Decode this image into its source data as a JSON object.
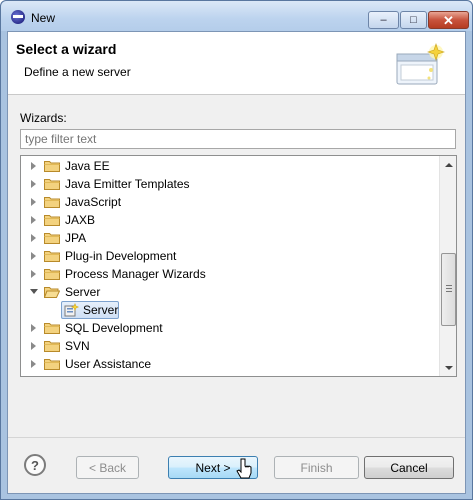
{
  "window": {
    "title": "New",
    "controls": {
      "minimize": "‒",
      "maximize": "□",
      "close": "✕"
    }
  },
  "header": {
    "title": "Select a wizard",
    "description": "Define a new server",
    "banner_icon": "new-wizard-banner-icon"
  },
  "wizards": {
    "label": "Wizards:",
    "filter_placeholder": "type filter text",
    "tree": [
      {
        "label": "Java EE",
        "expanded": false
      },
      {
        "label": "Java Emitter Templates",
        "expanded": false
      },
      {
        "label": "JavaScript",
        "expanded": false
      },
      {
        "label": "JAXB",
        "expanded": false
      },
      {
        "label": "JPA",
        "expanded": false
      },
      {
        "label": "Plug-in Development",
        "expanded": false
      },
      {
        "label": "Process Manager Wizards",
        "expanded": false
      },
      {
        "label": "Server",
        "expanded": true,
        "children": [
          {
            "label": "Server",
            "selected": true
          }
        ]
      },
      {
        "label": "SQL Development",
        "expanded": false
      },
      {
        "label": "SVN",
        "expanded": false
      },
      {
        "label": "User Assistance",
        "expanded": false
      }
    ]
  },
  "footer": {
    "help": "?",
    "back": "< Back",
    "next": "Next >",
    "finish": "Finish",
    "cancel": "Cancel"
  },
  "colors": {
    "folder": "#e8c36a",
    "selection": "#cfe0f5",
    "next_button_border": "#3c7fb1"
  }
}
